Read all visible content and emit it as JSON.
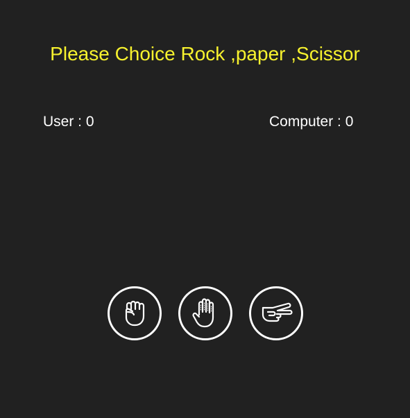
{
  "title": "Please Choice Rock ,paper ,Scissor",
  "scores": {
    "user_label": "User",
    "user_value": "0",
    "computer_label": "Computer",
    "computer_value": "0",
    "separator": " : "
  },
  "choices": [
    {
      "id": "rock",
      "icon": "fist-icon"
    },
    {
      "id": "paper",
      "icon": "open-hand-icon"
    },
    {
      "id": "scissors",
      "icon": "scissors-hand-icon"
    }
  ],
  "colors": {
    "background": "#212121",
    "title": "#f7f22e",
    "text": "#ffffff"
  }
}
